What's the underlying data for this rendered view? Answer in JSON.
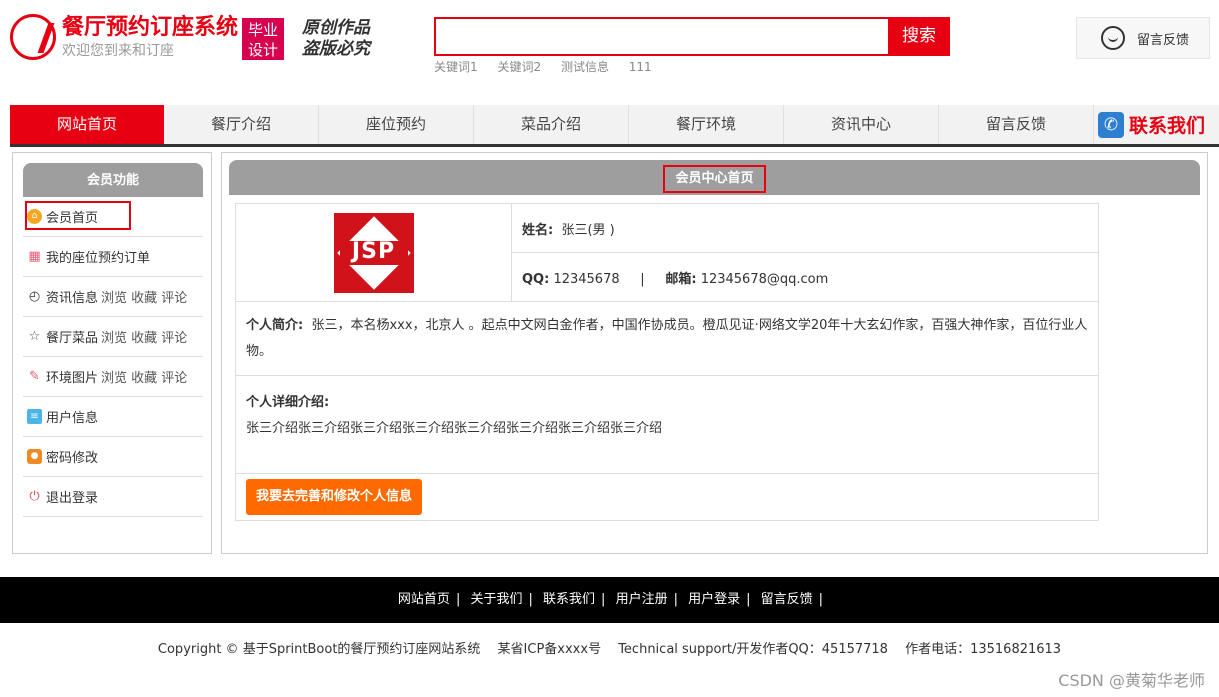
{
  "header": {
    "logo_title": "餐厅预约订座系统",
    "logo_sub": "欢迎您到来和订座",
    "badge_line1": "毕业",
    "badge_line2": "设计",
    "slogan_line1": "原创作品",
    "slogan_line2": "盗版必究",
    "search_placeholder": "",
    "search_button": "搜索",
    "hot_words": [
      "关键词1",
      "关键词2",
      "测试信息",
      "111"
    ],
    "feedback_label": "留言反馈"
  },
  "nav": {
    "items": [
      "网站首页",
      "餐厅介绍",
      "座位预约",
      "菜品介绍",
      "餐厅环境",
      "资讯中心",
      "留言反馈"
    ],
    "contact_label": "联系我们"
  },
  "sidebar": {
    "title": "会员功能",
    "items": [
      {
        "label": "会员首页",
        "extra": ""
      },
      {
        "label": "我的座位预约订单",
        "extra": ""
      },
      {
        "label": "资讯信息",
        "extra": "浏览 收藏 评论"
      },
      {
        "label": "餐厅菜品",
        "extra": "浏览 收藏 评论"
      },
      {
        "label": "环境图片",
        "extra": "浏览 收藏 评论"
      },
      {
        "label": "用户信息",
        "extra": ""
      },
      {
        "label": "密码修改",
        "extra": ""
      },
      {
        "label": "退出登录",
        "extra": ""
      }
    ]
  },
  "main": {
    "title": "会员中心首页",
    "avatar_text": "JSP",
    "name_label": "姓名:",
    "name_value": "张三(男 )",
    "qq_label": "QQ:",
    "qq_value": "12345678",
    "divider": "|",
    "email_label": "邮箱:",
    "email_value": "12345678@qq.com",
    "intro_label": "个人简介:",
    "intro_value": "张三，本名杨xxx，北京人 。起点中文网白金作者，中国作协成员。橙瓜见证·网络文学20年十大玄幻作家，百强大神作家，百位行业人物。",
    "detail_label": "个人详细介绍:",
    "detail_value": "张三介绍张三介绍张三介绍张三介绍张三介绍张三介绍张三介绍张三介绍",
    "edit_button": "我要去完善和修改个人信息"
  },
  "footer": {
    "links": [
      "网站首页",
      "关于我们",
      "联系我们",
      "用户注册",
      "用户登录",
      "留言反馈"
    ],
    "separator": "|",
    "copyright": "Copyright © 基于SprintBoot的餐厅预约订座网站系统　 某省ICP备xxxx号　 Technical support/开发作者QQ：45157718　 作者电话：13516821613",
    "watermark": "CSDN @黄菊华老师"
  },
  "colors": {
    "brand_red": "#e60012",
    "panel_gray": "#9e9e9e",
    "button_orange": "#ff6a00"
  }
}
